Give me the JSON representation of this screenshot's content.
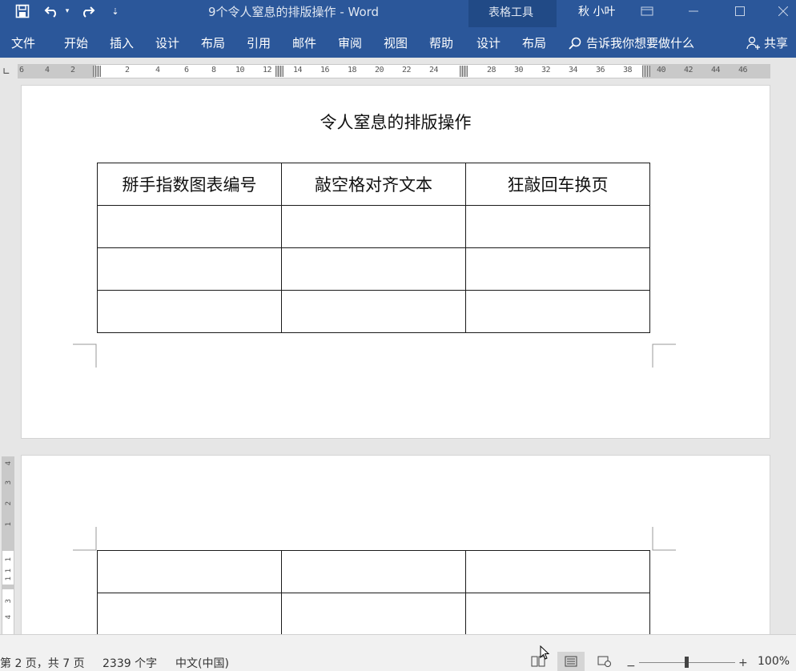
{
  "titlebar": {
    "title": "9个令人窒息的排版操作  -  Word",
    "context_tab_group": "表格工具",
    "user": "秋 小叶",
    "icons": [
      "save-icon",
      "undo-icon",
      "redo-icon",
      "customize-icon",
      "ribbon-display-icon",
      "minimize-icon",
      "maximize-icon",
      "close-icon"
    ]
  },
  "ribbon": {
    "tabs": [
      "文件",
      "开始",
      "插入",
      "设计",
      "布局",
      "引用",
      "邮件",
      "审阅",
      "视图",
      "帮助",
      "设计",
      "布局"
    ],
    "tell_me": "告诉我你想要做什么",
    "share": "共享"
  },
  "ruler": {
    "marks": [
      "6",
      "4",
      "2",
      "2",
      "4",
      "6",
      "8",
      "10",
      "12",
      "14",
      "16",
      "18",
      "20",
      "22",
      "24",
      "28",
      "30",
      "32",
      "34",
      "36",
      "38",
      "40",
      "42",
      "44",
      "46"
    ]
  },
  "vruler": {
    "marks": [
      "4",
      "3",
      "2",
      "1",
      "1",
      "1",
      "1",
      "3",
      "4"
    ]
  },
  "document": {
    "title": "令人窒息的排版操作",
    "table_headers": [
      "掰手指数图表编号",
      "敲空格对齐文本",
      "狂敲回车换页"
    ]
  },
  "status": {
    "page": "第 2 页，共 7 页",
    "words": "2339 个字",
    "language": "中文(中国)",
    "zoom": "100%"
  },
  "colors": {
    "ribbon": "#2b579a",
    "context_band": "#214a86"
  }
}
